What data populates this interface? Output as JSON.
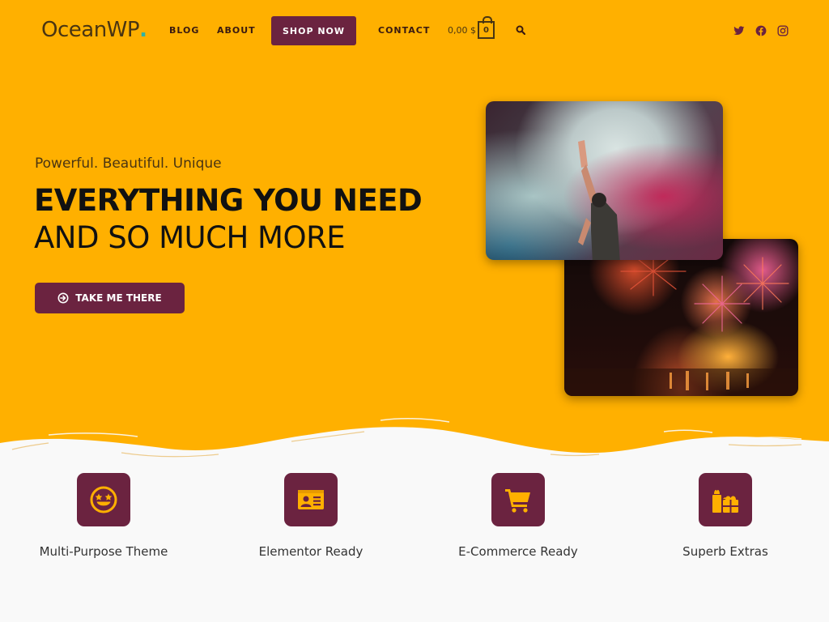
{
  "header": {
    "logo_text": "OceanWP",
    "logo_dot": ".",
    "nav": {
      "blog": "BLOG",
      "about": "ABOUT",
      "shop_now": "SHOP NOW",
      "contact": "CONTACT"
    },
    "cart": {
      "total": "0,00 $",
      "count": "0"
    },
    "social": [
      "twitter-icon",
      "facebook-icon",
      "instagram-icon"
    ]
  },
  "hero": {
    "tagline": "Powerful. Beautiful. Unique",
    "headline_line1": "EVERYTHING YOU NEED",
    "headline_line2": "AND SO MUCH MORE",
    "cta_label": "TAKE ME THERE",
    "images": [
      {
        "description": "Concert performer with raised hand in colored smoke"
      },
      {
        "description": "Fireworks over water at night"
      }
    ]
  },
  "features": [
    {
      "icon": "star-eyes-smiley-icon",
      "label": "Multi-Purpose Theme"
    },
    {
      "icon": "id-card-icon",
      "label": "Elementor Ready"
    },
    {
      "icon": "shopping-cart-icon",
      "label": "E-Commerce Ready"
    },
    {
      "icon": "gifts-icon",
      "label": "Superb Extras"
    }
  ],
  "colors": {
    "hero_bg": "#ffb000",
    "accent": "#6b2340",
    "icon_fill": "#ffb000",
    "page_bg": "#f9f9f9"
  }
}
